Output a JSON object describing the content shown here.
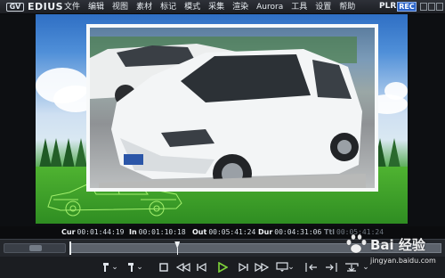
{
  "app": {
    "logo": "GV",
    "name": "EDIUS",
    "menu": [
      "文件",
      "编辑",
      "视图",
      "素材",
      "标记",
      "模式",
      "采集",
      "渲染",
      "Aurora",
      "工具",
      "设置",
      "帮助"
    ],
    "mode_label": "PLR",
    "mode_active": "REC"
  },
  "timecodes": {
    "cur_label": "Cur",
    "cur": "00:01:44:19",
    "in_label": "In",
    "in": "00:01:10:18",
    "out_label": "Out",
    "out": "00:05:41:24",
    "dur_label": "Dur",
    "dur": "00:04:31:06",
    "ttl_label": "Ttl",
    "ttl": "00:05:41:24"
  },
  "timeline": {
    "playhead_fraction": 0.29
  },
  "controls": {
    "icons": [
      "mark-in-icon",
      "mark-out-icon",
      "stop-icon",
      "rewind-icon",
      "step-back-icon",
      "play-icon",
      "step-forward-icon",
      "fast-forward-icon",
      "loop-play-icon",
      "insert-icon",
      "overwrite-icon",
      "export-icon"
    ]
  },
  "watermark": {
    "text": "Bai 经验",
    "url": "jingyan.baidu.com"
  },
  "colors": {
    "accent_rec": "#2a63c7",
    "play_green": "#7fd43a",
    "wire_car": "#9dff6a"
  }
}
